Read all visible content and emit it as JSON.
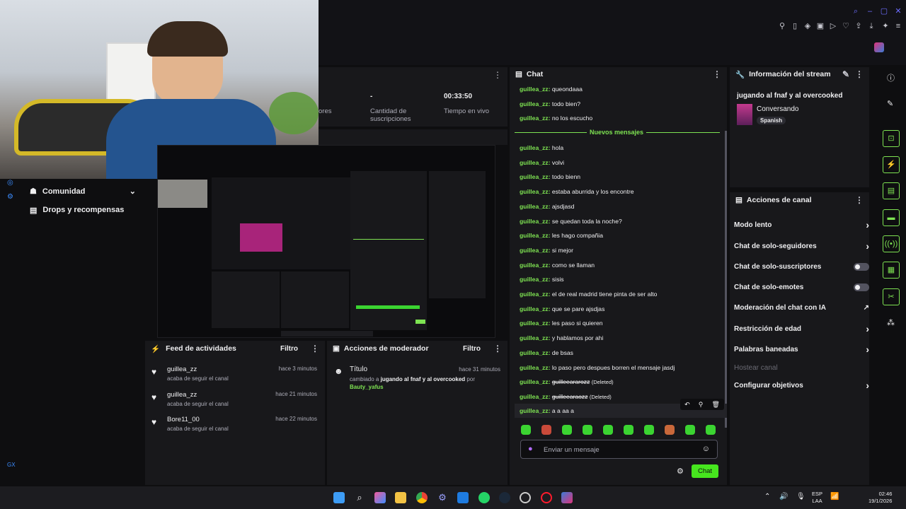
{
  "stats": {
    "followers_label": "ores",
    "subs_value": "-",
    "subs_label": "Cantidad de suscripciones",
    "live_value": "00:33:50",
    "live_label": "Tiempo en vivo"
  },
  "leftnav": {
    "community": "Comunidad",
    "drops": "Drops y recompensas"
  },
  "chat": {
    "title": "Chat",
    "new_messages": "Nuevos mensajes",
    "user": "guillea_zz:",
    "old_messages": [
      "queondaaa",
      "todo bien?",
      "no los escucho"
    ],
    "messages": [
      "hola",
      "volvi",
      "todo bienn",
      "estaba aburrida y los encontre",
      "ajsdjasd",
      "se quedan toda la noche?",
      "les hago compañia",
      "si mejor",
      "como se llaman",
      "sisis",
      "el de real madrid tiene pinta de ser alto",
      "que se pare ajsdjas",
      "les paso si quieren",
      "y hablamos por ahi",
      "de bsas",
      "lo paso pero despues borren el mensaje jasdj"
    ],
    "deleted_1": "guilleeararozz",
    "deleted_2": "guilleearaozz",
    "deleted_tag": "(Deleted)",
    "last_message": "a a aa a",
    "input_placeholder": "Enviar un mensaje",
    "send_label": "Chat"
  },
  "stream_info": {
    "title": "Información del stream",
    "stream_title": "jugando al fnaf y al overcooked",
    "category": "Conversando",
    "language": "Spanish"
  },
  "channel_actions": {
    "title": "Acciones de canal",
    "items": [
      {
        "label": "Modo lento",
        "kind": "chevron"
      },
      {
        "label": "Chat de solo-seguidores",
        "kind": "chevron"
      },
      {
        "label": "Chat de solo-suscriptores",
        "kind": "toggle"
      },
      {
        "label": "Chat de solo-emotes",
        "kind": "toggle"
      },
      {
        "label": "Moderación del chat con IA",
        "kind": "external"
      },
      {
        "label": "Restricción de edad",
        "kind": "chevron"
      },
      {
        "label": "Palabras baneadas",
        "kind": "chevron"
      },
      {
        "label": "Hostear canal",
        "kind": "disabled"
      },
      {
        "label": "Configurar objetivos",
        "kind": "chevron"
      }
    ]
  },
  "activity_feed": {
    "title": "Feed de actividades",
    "filter": "Filtro",
    "items": [
      {
        "name": "guillea_zz",
        "sub": "acaba de seguir el canal",
        "time": "hace 3 minutos"
      },
      {
        "name": "guillea_zz",
        "sub": "acaba de seguir el canal",
        "time": "hace 21 minutos"
      },
      {
        "name": "Bore11_00",
        "sub": "acaba de seguir el canal",
        "time": "hace 22 minutos"
      }
    ]
  },
  "mod_actions": {
    "title": "Acciones de moderador",
    "filter": "Filtro",
    "entry_title": "Título",
    "entry_time": "hace 31 minutos",
    "entry_prefix": "cambiado a",
    "entry_value": "jugando al fnaf y al overcooked",
    "entry_by": "por",
    "entry_user": "Bauty_yafus"
  },
  "taskbar": {
    "lang": "ESP",
    "layout": "LAA",
    "time": "02:46",
    "date": "19/1/2026"
  },
  "colors": {
    "accent": "#7ee352",
    "panel": "#18181b",
    "background": "#0e0e10"
  }
}
